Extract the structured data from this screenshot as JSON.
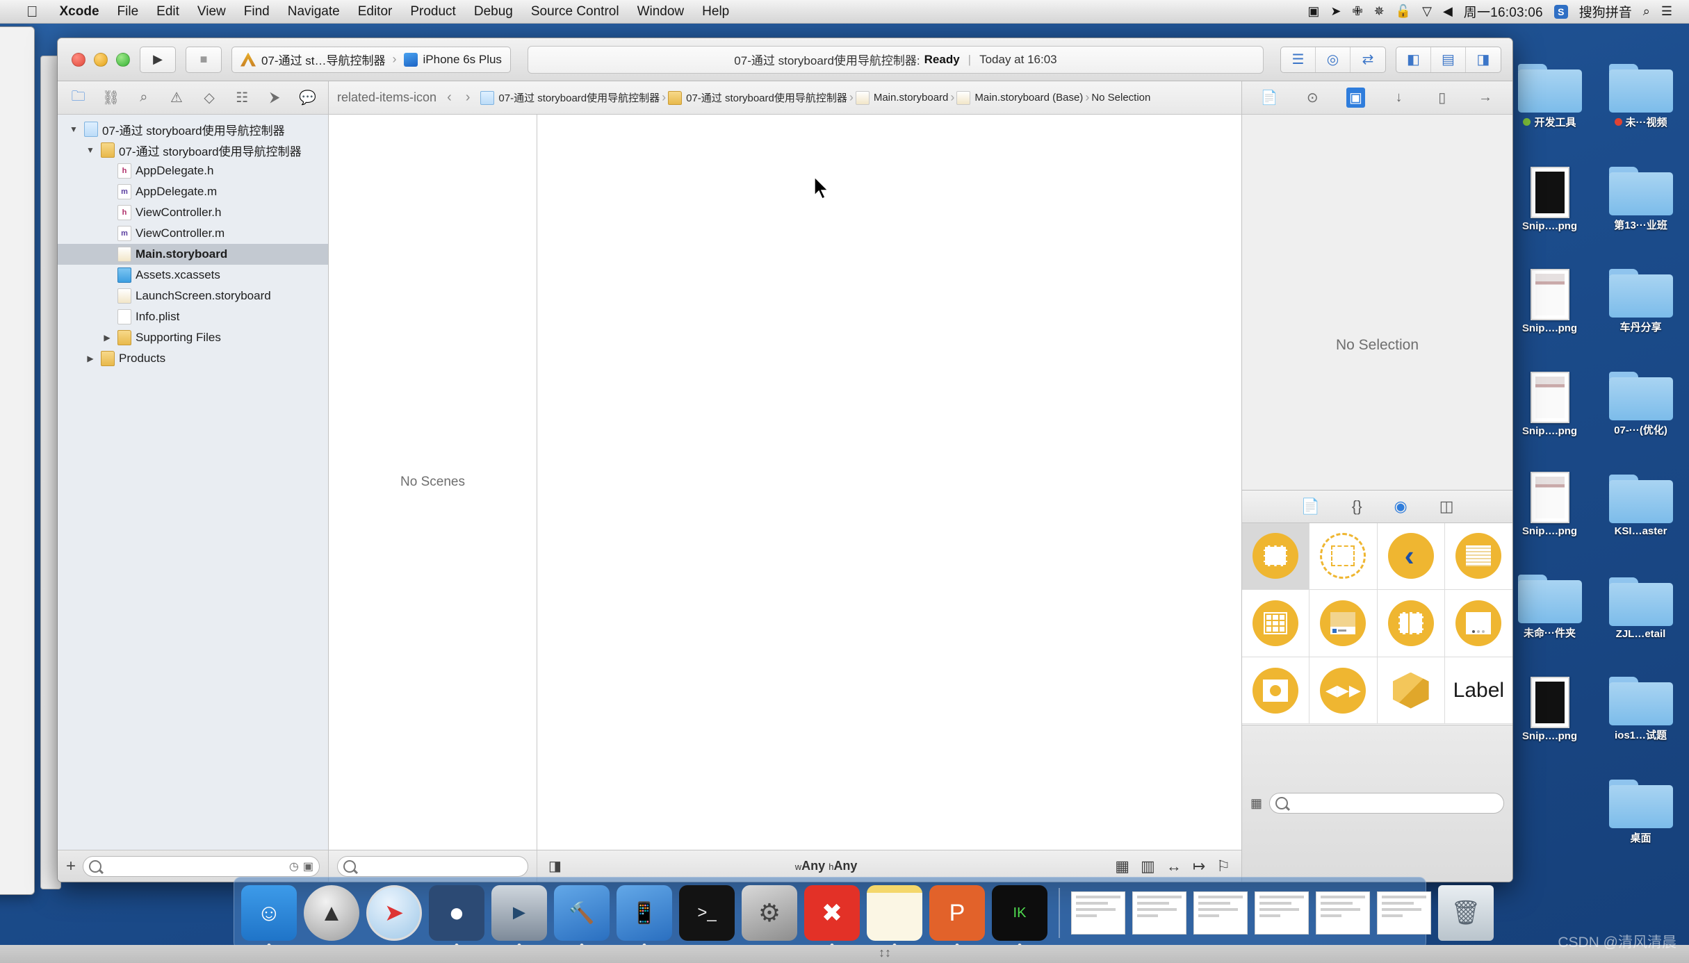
{
  "menubar": {
    "apple_icon": "apple-logo-icon",
    "items": [
      {
        "label": "Xcode",
        "bold": true
      },
      {
        "label": "File",
        "bold": false
      },
      {
        "label": "Edit",
        "bold": false
      },
      {
        "label": "View",
        "bold": false
      },
      {
        "label": "Find",
        "bold": false
      },
      {
        "label": "Navigate",
        "bold": false
      },
      {
        "label": "Editor",
        "bold": false
      },
      {
        "label": "Product",
        "bold": false
      },
      {
        "label": "Debug",
        "bold": false
      },
      {
        "label": "Source Control",
        "bold": false
      },
      {
        "label": "Window",
        "bold": false
      },
      {
        "label": "Help",
        "bold": false
      }
    ],
    "status_icons": [
      {
        "name": "screen-record-icon",
        "glyph": "▣"
      },
      {
        "name": "location-arrow-icon",
        "glyph": "➤"
      },
      {
        "name": "bluetooth-icon",
        "glyph": "✙"
      },
      {
        "name": "airplay-icon",
        "glyph": "✵"
      },
      {
        "name": "lock-icon",
        "glyph": "🔓"
      },
      {
        "name": "dropbox-icon",
        "glyph": "▽"
      },
      {
        "name": "volume-icon",
        "glyph": "◀"
      }
    ],
    "clock": "周一16:03:06",
    "input_method_badge": "S",
    "input_method_label": "搜狗拼音",
    "search_icon": "spotlight-search-icon",
    "notification_icon": "notification-center-icon"
  },
  "xcode": {
    "toolbar": {
      "run_button": "▶",
      "stop_button": "■",
      "scheme_name": "07-通过 st…导航控制器",
      "scheme_separator": "›",
      "destination": "iPhone 6s Plus",
      "status_project": "07-通过 storyboard使用导航控制器:",
      "status_state": "Ready",
      "status_pipe": "|",
      "status_time": "Today at 16:03",
      "editor_buttons": [
        {
          "name": "standard-editor-button",
          "glyph": "☰"
        },
        {
          "name": "assistant-editor-button",
          "glyph": "◎"
        },
        {
          "name": "version-editor-button",
          "glyph": "⇄"
        }
      ],
      "view_buttons": [
        {
          "name": "toggle-navigator-button",
          "glyph": "◧"
        },
        {
          "name": "toggle-debug-area-button",
          "glyph": "▤"
        },
        {
          "name": "toggle-utilities-button",
          "glyph": "◨"
        }
      ]
    },
    "navigator": {
      "tabs": [
        {
          "name": "project-navigator-tab",
          "glyph": "🗀",
          "active": true
        },
        {
          "name": "source-control-navigator-tab",
          "glyph": "⛓",
          "active": false
        },
        {
          "name": "symbol-navigator-tab",
          "glyph": "⌕",
          "active": false
        },
        {
          "name": "issue-navigator-tab",
          "glyph": "⚠",
          "active": false
        },
        {
          "name": "test-navigator-tab",
          "glyph": "◇",
          "active": false
        },
        {
          "name": "debug-navigator-tab",
          "glyph": "☷",
          "active": false
        },
        {
          "name": "breakpoint-navigator-tab",
          "glyph": "⮞",
          "active": false
        },
        {
          "name": "report-navigator-tab",
          "glyph": "💬",
          "active": false
        }
      ],
      "tree": [
        {
          "label": "07-通过 storyboard使用导航控制器",
          "indent": 0,
          "twisty": "▼",
          "icon": "project-icon",
          "badge": "",
          "selected": false
        },
        {
          "label": "07-通过 storyboard使用导航控制器",
          "indent": 1,
          "twisty": "▼",
          "icon": "folder-icon",
          "badge": "",
          "selected": false
        },
        {
          "label": "AppDelegate.h",
          "indent": 2,
          "twisty": "",
          "icon": "header-file-icon",
          "badge": "h",
          "selected": false
        },
        {
          "label": "AppDelegate.m",
          "indent": 2,
          "twisty": "",
          "icon": "objc-file-icon",
          "badge": "m",
          "selected": false
        },
        {
          "label": "ViewController.h",
          "indent": 2,
          "twisty": "",
          "icon": "header-file-icon",
          "badge": "h",
          "selected": false
        },
        {
          "label": "ViewController.m",
          "indent": 2,
          "twisty": "",
          "icon": "objc-file-icon",
          "badge": "m",
          "selected": false
        },
        {
          "label": "Main.storyboard",
          "indent": 2,
          "twisty": "",
          "icon": "storyboard-file-icon",
          "badge": "",
          "selected": true
        },
        {
          "label": "Assets.xcassets",
          "indent": 2,
          "twisty": "",
          "icon": "asset-catalog-icon",
          "badge": "",
          "selected": false
        },
        {
          "label": "LaunchScreen.storyboard",
          "indent": 2,
          "twisty": "",
          "icon": "storyboard-file-icon",
          "badge": "",
          "selected": false
        },
        {
          "label": "Info.plist",
          "indent": 2,
          "twisty": "",
          "icon": "plist-file-icon",
          "badge": "",
          "selected": false
        },
        {
          "label": "Supporting Files",
          "indent": 2,
          "twisty": "▶",
          "icon": "folder-icon",
          "badge": "",
          "selected": false
        },
        {
          "label": "Products",
          "indent": 1,
          "twisty": "▶",
          "icon": "folder-icon",
          "badge": "",
          "selected": false
        }
      ],
      "footer": {
        "add_button": "+",
        "filter_placeholder": "",
        "recent_icon": "clock-filter-icon",
        "unsaved_icon": "modified-filter-icon"
      }
    },
    "editor": {
      "jumpbar": {
        "grid_icon": "related-items-icon",
        "back_arrow": "‹",
        "forward_arrow": "›",
        "crumbs": [
          {
            "label": "07-通过 storyboard使用导航控制器",
            "icon": "project-icon"
          },
          {
            "label": "07-通过 storyboard使用导航控制器",
            "icon": "folder-icon"
          },
          {
            "label": "Main.storyboard",
            "icon": "storyboard-file-icon"
          },
          {
            "label": "Main.storyboard (Base)",
            "icon": "storyboard-file-icon"
          },
          {
            "label": "No Selection",
            "icon": ""
          }
        ]
      },
      "document_outline": {
        "empty_message": "No Scenes"
      },
      "footer": {
        "filter_placeholder": "",
        "size_toggle_icon": "show-hide-outline-icon",
        "size_class_w_prefix": "w",
        "size_class_w_value": "Any",
        "size_class_h_prefix": "h",
        "size_class_h_value": "Any",
        "tools": [
          {
            "name": "auto-layout-update-frames-icon",
            "glyph": "▦"
          },
          {
            "name": "auto-layout-embed-icon",
            "glyph": "▥"
          },
          {
            "name": "auto-layout-align-icon",
            "glyph": "↔"
          },
          {
            "name": "auto-layout-pin-icon",
            "glyph": "↦"
          },
          {
            "name": "auto-layout-resolve-icon",
            "glyph": "⚐"
          }
        ]
      }
    },
    "utilities": {
      "inspector_tabs": [
        {
          "name": "file-inspector-tab",
          "glyph": "📄",
          "active": false
        },
        {
          "name": "quick-help-inspector-tab",
          "glyph": "⊙",
          "active": false
        },
        {
          "name": "identity-inspector-tab",
          "glyph": "▣",
          "active": true
        },
        {
          "name": "attributes-inspector-tab",
          "glyph": "↓",
          "active": false
        },
        {
          "name": "size-inspector-tab",
          "glyph": "▯",
          "active": false
        },
        {
          "name": "connections-inspector-tab",
          "glyph": "→",
          "active": false
        }
      ],
      "inspector_empty": "No Selection",
      "library_tabs": [
        {
          "name": "file-template-library-tab",
          "glyph": "📄",
          "active": false
        },
        {
          "name": "code-snippet-library-tab",
          "glyph": "{}",
          "active": false
        },
        {
          "name": "object-library-tab",
          "glyph": "◉",
          "active": true
        },
        {
          "name": "media-library-tab",
          "glyph": "◫",
          "active": false
        }
      ],
      "library_items": [
        {
          "name": "view-controller-object",
          "kind": "sq",
          "selected": true
        },
        {
          "name": "storyboard-reference-object",
          "kind": "dashed",
          "selected": false
        },
        {
          "name": "navigation-controller-object",
          "kind": "chev",
          "selected": false
        },
        {
          "name": "table-view-controller-object",
          "kind": "lines",
          "selected": false
        },
        {
          "name": "collection-view-controller-object",
          "kind": "grid9",
          "selected": false
        },
        {
          "name": "tab-bar-controller-object",
          "kind": "tabbar",
          "selected": false
        },
        {
          "name": "split-view-controller-object",
          "kind": "split",
          "selected": false
        },
        {
          "name": "page-view-controller-object",
          "kind": "page",
          "selected": false
        },
        {
          "name": "gl-kit-view-controller-object",
          "kind": "glkit",
          "selected": false
        },
        {
          "name": "avkit-player-controller-object",
          "kind": "player",
          "selected": false
        },
        {
          "name": "object-cube",
          "kind": "cube",
          "selected": false
        },
        {
          "name": "label-object",
          "kind": "label",
          "label": "Label",
          "selected": false
        }
      ],
      "library_footer": {
        "layout_icon": "library-layout-icon",
        "filter_placeholder": ""
      }
    }
  },
  "desktop": {
    "icons": [
      {
        "label": "开发工具",
        "type": "folder",
        "dot": "#7ec13a"
      },
      {
        "label": "未···视频",
        "type": "folder",
        "dot": "#e04232"
      },
      {
        "label": "Snip….png",
        "type": "file-dark",
        "dot": ""
      },
      {
        "label": "第13···业班",
        "type": "folder",
        "dot": ""
      },
      {
        "label": "Snip….png",
        "type": "file-shot",
        "dot": ""
      },
      {
        "label": "车丹分享",
        "type": "folder",
        "dot": ""
      },
      {
        "label": "Snip….png",
        "type": "file-shot",
        "dot": ""
      },
      {
        "label": "07-···(优化)",
        "type": "folder",
        "dot": ""
      },
      {
        "label": "Snip….png",
        "type": "file-shot",
        "dot": ""
      },
      {
        "label": "KSI…aster",
        "type": "folder",
        "dot": ""
      },
      {
        "label": "未命···件夹",
        "type": "folder",
        "dot": ""
      },
      {
        "label": "ZJL…etail",
        "type": "folder",
        "dot": ""
      },
      {
        "label": "Snip….png",
        "type": "file-dark",
        "dot": ""
      },
      {
        "label": "ios1…试题",
        "type": "folder",
        "dot": ""
      },
      {
        "label": "",
        "type": "none",
        "dot": ""
      },
      {
        "label": "桌面",
        "type": "folder",
        "dot": ""
      }
    ]
  },
  "dock": {
    "apps": [
      {
        "name": "finder-dock-icon",
        "running": true
      },
      {
        "name": "launchpad-dock-icon",
        "running": false
      },
      {
        "name": "safari-dock-icon",
        "running": false
      },
      {
        "name": "mouse-app-dock-icon",
        "running": true
      },
      {
        "name": "quicktime-dock-icon",
        "running": true
      },
      {
        "name": "xcode-dock-icon",
        "running": true
      },
      {
        "name": "xcode-beta-dock-icon",
        "running": true
      },
      {
        "name": "terminal-dock-icon",
        "running": false
      },
      {
        "name": "system-preferences-dock-icon",
        "running": false
      },
      {
        "name": "xmind-dock-icon",
        "running": true
      },
      {
        "name": "notes-dock-icon",
        "running": true
      },
      {
        "name": "sublime-dock-icon",
        "running": true
      },
      {
        "name": "iterm-dock-icon",
        "running": true
      }
    ],
    "minimized": [
      {
        "name": "minimized-window-1"
      },
      {
        "name": "minimized-window-2"
      },
      {
        "name": "minimized-window-3"
      },
      {
        "name": "minimized-window-4"
      },
      {
        "name": "minimized-window-5"
      },
      {
        "name": "minimized-window-6"
      }
    ],
    "trash": {
      "name": "trash-dock-icon"
    }
  },
  "watermark": "CSDN @清风清晨"
}
